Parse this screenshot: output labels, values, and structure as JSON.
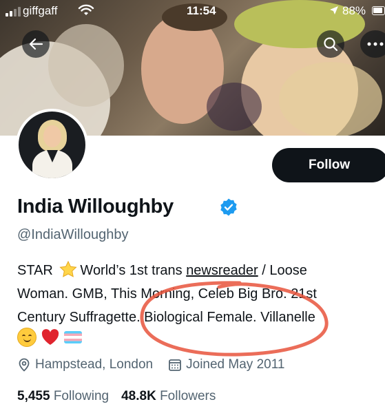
{
  "status_bar": {
    "carrier": "giffgaff",
    "time": "11:54",
    "battery": "88%"
  },
  "profile": {
    "name": "India Willoughby",
    "handle": "@IndiaWilloughby",
    "follow_label": "Follow",
    "bio_lines": [
      {
        "before": "STAR",
        "after": "World’s 1st trans ",
        "underlined": "newsreader",
        "tail": " / Loose"
      },
      "Woman. GMB, This Morning, Celeb Big Bro. 21st",
      "Century Suffragette. Biological Female. Villanelle"
    ],
    "location": "Hampstead, London",
    "joined": "Joined May 2011",
    "following_count": "5,455",
    "following_label": "Following",
    "followers_count": "48.8K",
    "followers_label": "Followers"
  },
  "icons": [
    "signal-icon",
    "wifi-icon",
    "location-arrow-icon",
    "battery-icon",
    "back-arrow-icon",
    "search-icon",
    "more-icon",
    "verified-badge-icon",
    "star-emoji-icon",
    "smile-emoji-icon",
    "heart-emoji-icon",
    "trans-flag-emoji-icon",
    "location-pin-icon",
    "calendar-icon"
  ],
  "colors": {
    "follow_button": "#0f1419",
    "verified": "#1d9bf0",
    "secondary_text": "#536471",
    "annotation": "#e8533c"
  }
}
